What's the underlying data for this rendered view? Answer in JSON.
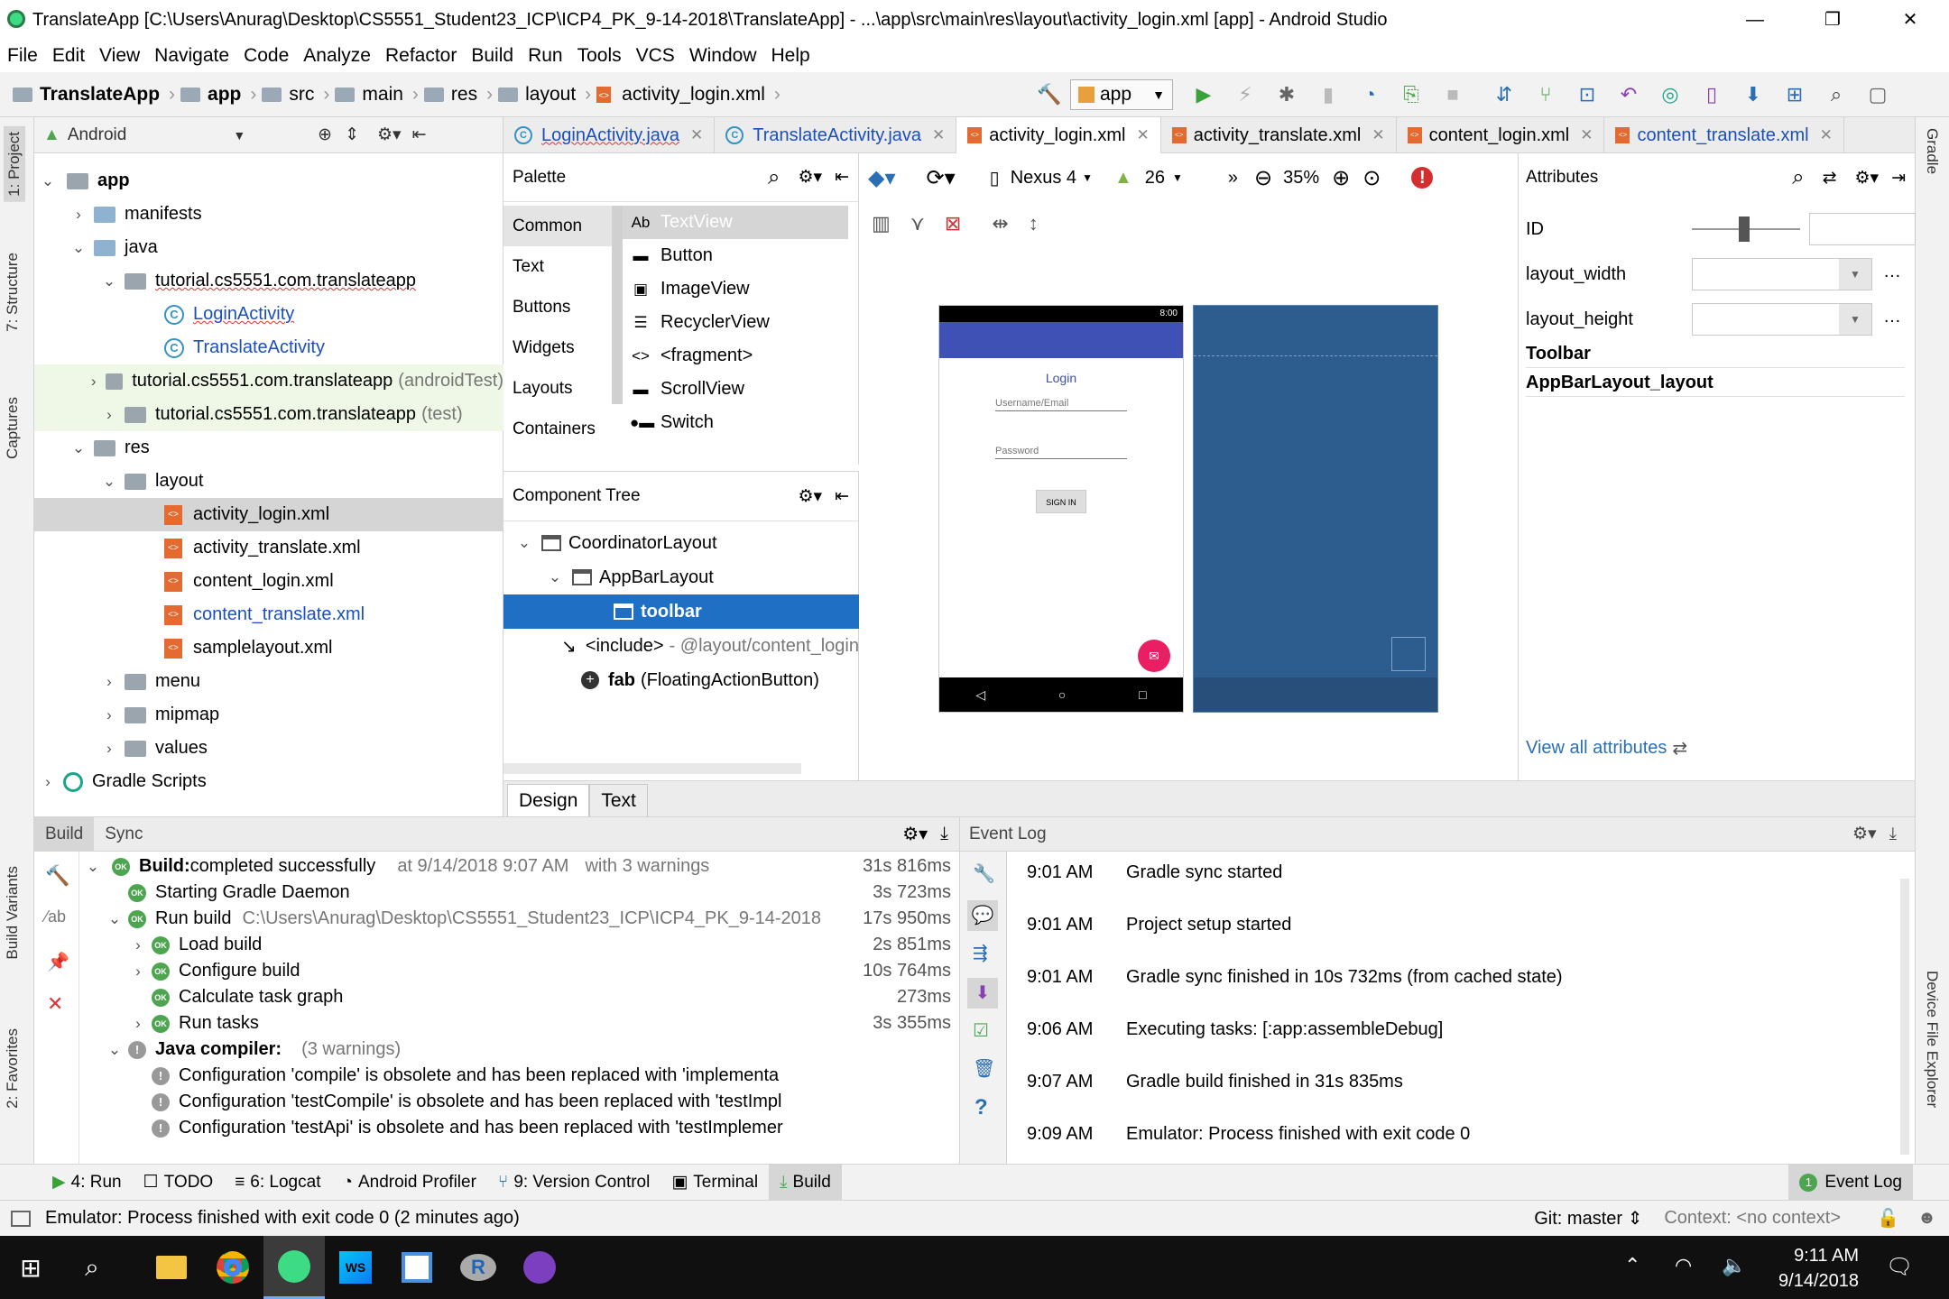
{
  "window": {
    "title": "TranslateApp [C:\\Users\\Anurag\\Desktop\\CS5551_Student23_ICP\\ICP4_PK_9-14-2018\\TranslateApp] - ...\\app\\src\\main\\res\\layout\\activity_login.xml [app] - Android Studio",
    "min": "—",
    "max": "❐",
    "close": "✕"
  },
  "menu": [
    "File",
    "Edit",
    "View",
    "Navigate",
    "Code",
    "Analyze",
    "Refactor",
    "Build",
    "Run",
    "Tools",
    "VCS",
    "Window",
    "Help"
  ],
  "breadcrumbs": [
    "TranslateApp",
    "app",
    "src",
    "main",
    "res",
    "layout",
    "activity_login.xml"
  ],
  "run_config": "app",
  "left_tabs": {
    "project": "1: Project",
    "structure": "7: Structure",
    "captures": "Captures",
    "build_variants": "Build Variants",
    "favorites": "2: Favorites"
  },
  "right_tabs": {
    "gradle": "Gradle",
    "device_explorer": "Device File Explorer"
  },
  "project": {
    "view": "Android",
    "tree": [
      {
        "label": "app",
        "bold": true
      },
      {
        "label": "manifests"
      },
      {
        "label": "java"
      },
      {
        "label": "tutorial.cs5551.com.translateapp"
      },
      {
        "label": "LoginActivity"
      },
      {
        "label": "TranslateActivity"
      },
      {
        "label": "tutorial.cs5551.com.translateapp",
        "suffix": "(androidTest)"
      },
      {
        "label": "tutorial.cs5551.com.translateapp",
        "suffix": "(test)"
      },
      {
        "label": "res"
      },
      {
        "label": "layout"
      },
      {
        "label": "activity_login.xml"
      },
      {
        "label": "activity_translate.xml"
      },
      {
        "label": "content_login.xml"
      },
      {
        "label": "content_translate.xml"
      },
      {
        "label": "samplelayout.xml"
      },
      {
        "label": "menu"
      },
      {
        "label": "mipmap"
      },
      {
        "label": "values"
      },
      {
        "label": "Gradle Scripts"
      }
    ]
  },
  "editor_tabs": [
    "LoginActivity.java",
    "TranslateActivity.java",
    "activity_login.xml",
    "activity_translate.xml",
    "content_login.xml",
    "content_translate.xml"
  ],
  "palette": {
    "title": "Palette",
    "categories": [
      "Common",
      "Text",
      "Buttons",
      "Widgets",
      "Layouts",
      "Containers"
    ],
    "items": [
      "TextView",
      "Button",
      "ImageView",
      "RecyclerView",
      "<fragment>",
      "ScrollView",
      "Switch"
    ]
  },
  "component_tree": {
    "title": "Component Tree",
    "rows": [
      {
        "label": "CoordinatorLayout"
      },
      {
        "label": "AppBarLayout"
      },
      {
        "label": "toolbar"
      },
      {
        "label": "<include>",
        "suffix": "- @layout/content_login"
      },
      {
        "label": "fab",
        "suffix": "(FloatingActionButton)"
      }
    ]
  },
  "design_toolbar": {
    "device": "Nexus 4",
    "api": "26",
    "zoom": "35%"
  },
  "phone": {
    "time": "8:00",
    "title": "Login",
    "username_hint": "Username/Email",
    "password_hint": "Password",
    "button": "SIGN IN"
  },
  "attributes": {
    "title": "Attributes",
    "rows": [
      "ID",
      "layout_width",
      "layout_height"
    ],
    "sections": [
      "Toolbar",
      "AppBarLayout_layout"
    ],
    "view_all": "View all attributes"
  },
  "design_tabs": [
    "Design",
    "Text"
  ],
  "build": {
    "tabs": [
      "Build",
      "Sync"
    ],
    "rows": [
      {
        "text": "Build:",
        "rest": " completed successfully",
        "at": "at 9/14/2018 9:07 AM",
        "warn": "with 3 warnings",
        "time": "31s 816ms"
      },
      {
        "text": "Starting Gradle Daemon",
        "time": "3s 723ms"
      },
      {
        "text": "Run build",
        "path": "C:\\Users\\Anurag\\Desktop\\CS5551_Student23_ICP\\ICP4_PK_9-14-2018",
        "time": "17s 950ms"
      },
      {
        "text": "Load build",
        "time": "2s 851ms"
      },
      {
        "text": "Configure build",
        "time": "10s 764ms"
      },
      {
        "text": "Calculate task graph",
        "time": "273ms"
      },
      {
        "text": "Run tasks",
        "time": "3s 355ms"
      },
      {
        "text": "Java compiler:",
        "rest": "(3 warnings)"
      },
      {
        "text": "Configuration 'compile' is obsolete and has been replaced with 'implementa"
      },
      {
        "text": "Configuration 'testCompile' is obsolete and has been replaced with 'testImpl"
      },
      {
        "text": "Configuration 'testApi' is obsolete and has been replaced with 'testImplemer"
      }
    ]
  },
  "event_log": {
    "title": "Event Log",
    "rows": [
      {
        "time": "9:01 AM",
        "msg": "Gradle sync started"
      },
      {
        "time": "9:01 AM",
        "msg": "Project setup started"
      },
      {
        "time": "9:01 AM",
        "msg": "Gradle sync finished in 10s 732ms (from cached state)"
      },
      {
        "time": "9:06 AM",
        "msg": "Executing tasks: [:app:assembleDebug]"
      },
      {
        "time": "9:07 AM",
        "msg": "Gradle build finished in 31s 835ms"
      },
      {
        "time": "9:09 AM",
        "msg": "Emulator: Process finished with exit code 0"
      }
    ]
  },
  "bottom_tools": [
    "4: Run",
    "TODO",
    "6: Logcat",
    "Android Profiler",
    "9: Version Control",
    "Terminal",
    "Build"
  ],
  "event_log_badge": "1",
  "event_log_label": "Event Log",
  "status": {
    "message": "Emulator: Process finished with exit code 0 (2 minutes ago)",
    "git": "Git: master ⇕",
    "context": "Context: <no context>"
  },
  "clock": {
    "time": "9:11 AM",
    "date": "9/14/2018"
  }
}
